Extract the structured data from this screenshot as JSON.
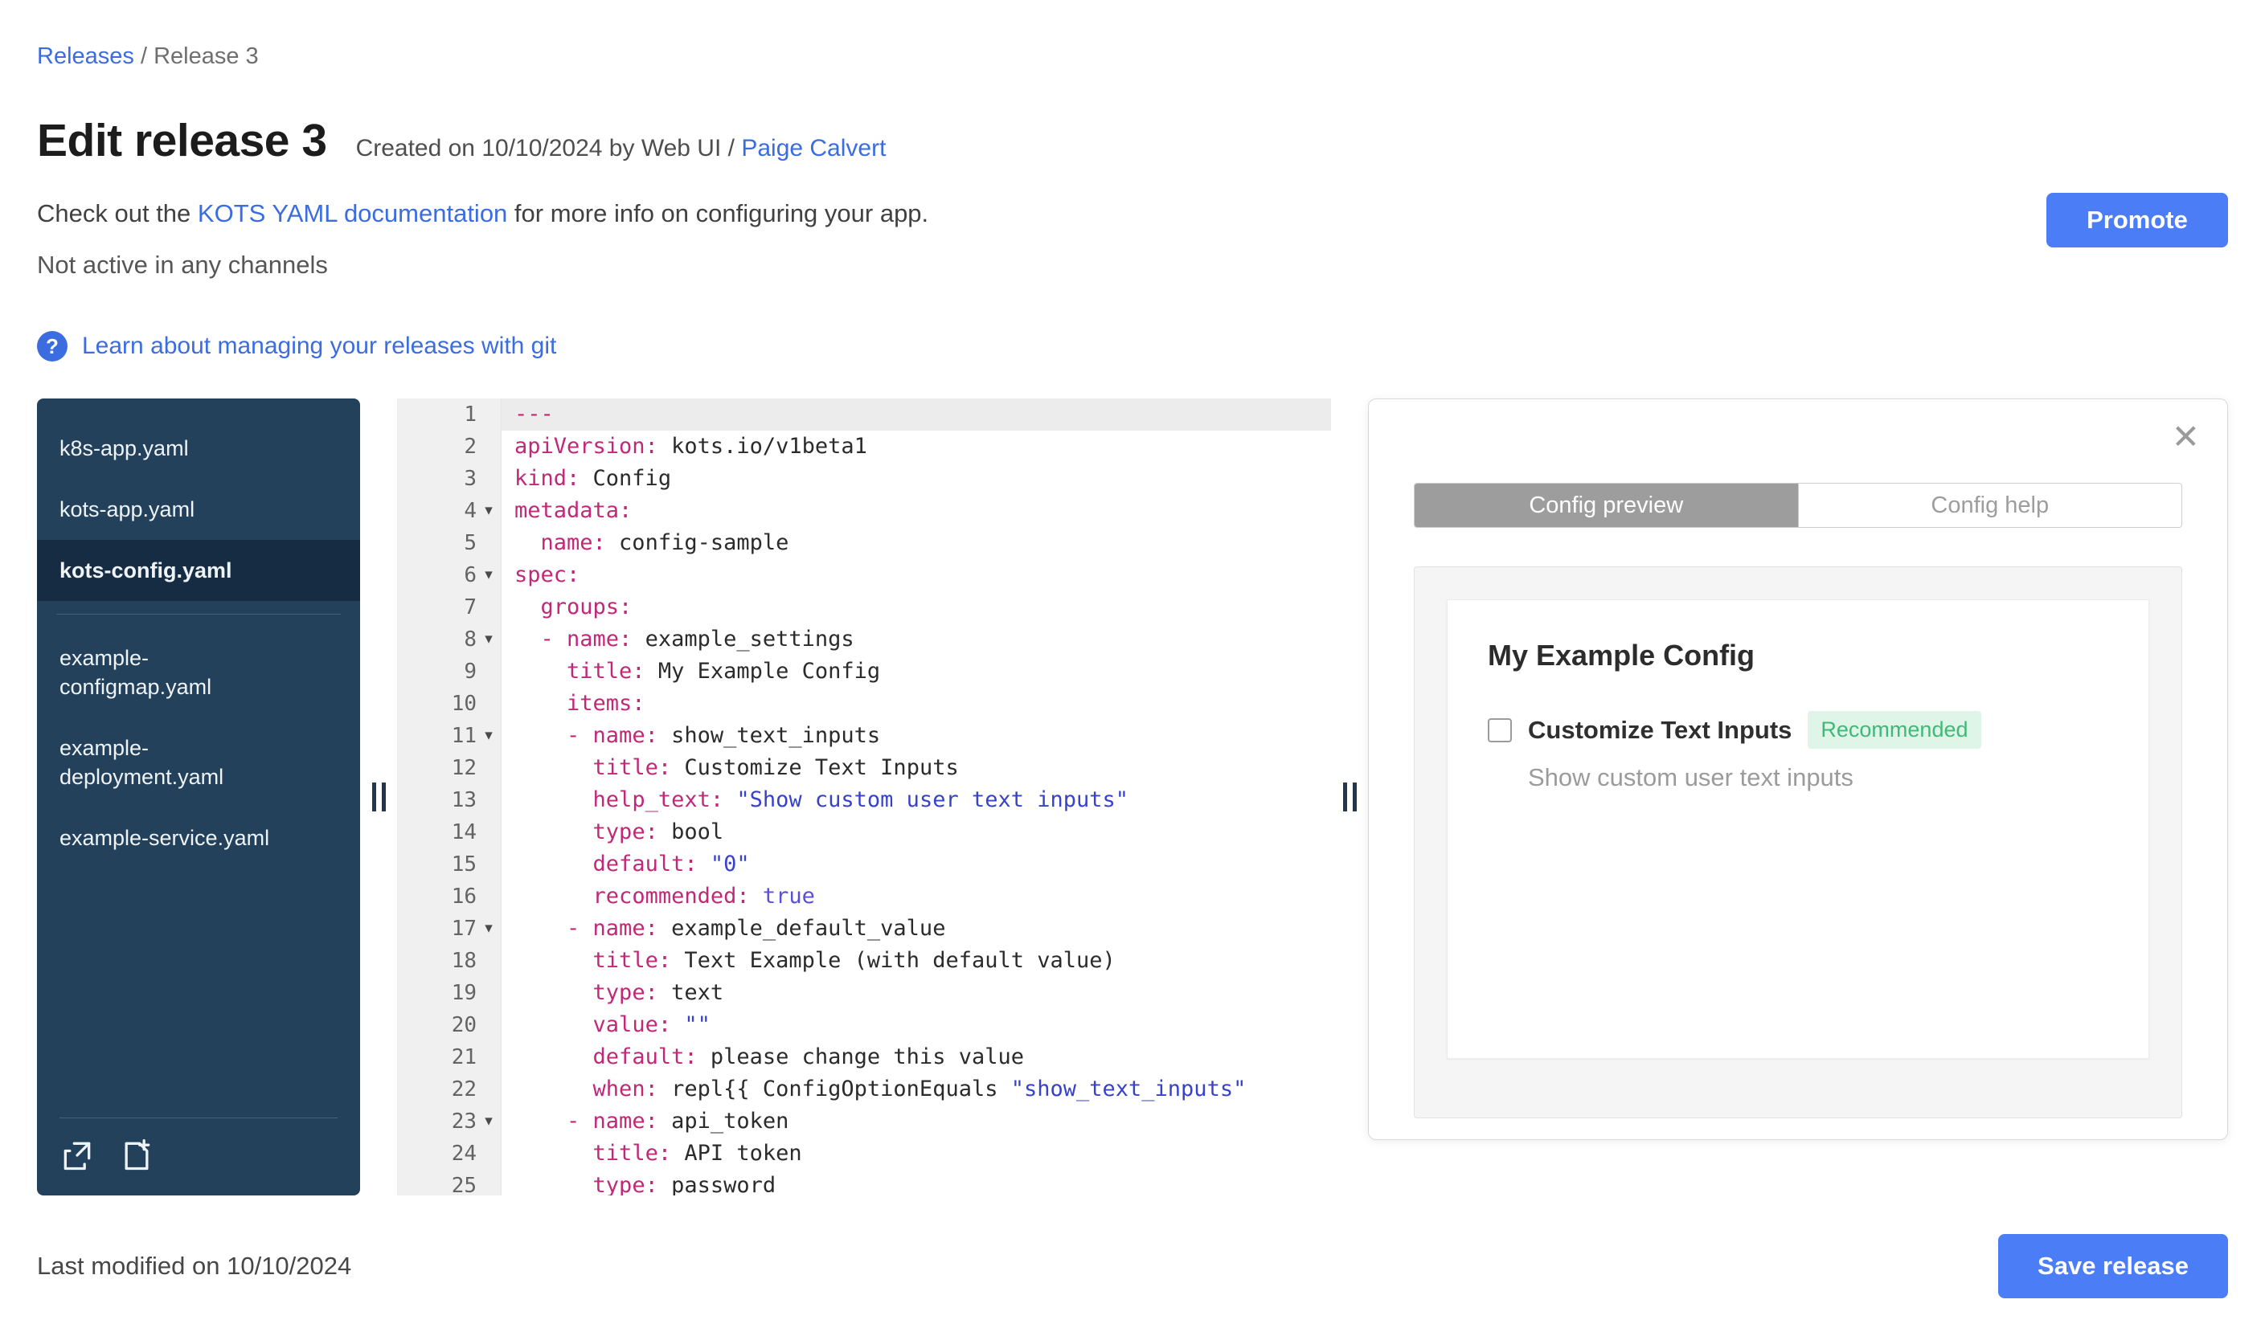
{
  "breadcrumb": {
    "releases": "Releases",
    "separator": "/",
    "current": "Release 3"
  },
  "header": {
    "title": "Edit release 3",
    "created_prefix": "Created on 10/10/2024 by Web UI / ",
    "created_by": "Paige Calvert",
    "docs_prefix": "Check out the ",
    "docs_link": "KOTS YAML documentation",
    "docs_suffix": " for more info on configuring your app.",
    "channel_status": "Not active in any channels",
    "promote_label": "Promote",
    "git_help_link": "Learn about managing your releases with git"
  },
  "icons": {
    "help": "?",
    "close": "✕",
    "fold": "▾"
  },
  "file_tree": {
    "files_top": [
      {
        "label": "k8s-app.yaml",
        "active": false
      },
      {
        "label": "kots-app.yaml",
        "active": false
      },
      {
        "label": "kots-config.yaml",
        "active": true
      }
    ],
    "files_bottom": [
      {
        "label": "example-configmap.yaml",
        "active": false
      },
      {
        "label": "example-deployment.yaml",
        "active": false
      },
      {
        "label": "example-service.yaml",
        "active": false
      }
    ]
  },
  "editor": {
    "lines": [
      {
        "n": 1,
        "fold": false,
        "active": true,
        "seg": [
          {
            "c": "k",
            "t": "---"
          }
        ]
      },
      {
        "n": 2,
        "fold": false,
        "active": false,
        "seg": [
          {
            "c": "k",
            "t": "apiVersion:"
          },
          {
            "c": "v",
            "t": " kots.io/v1beta1"
          }
        ]
      },
      {
        "n": 3,
        "fold": false,
        "active": false,
        "seg": [
          {
            "c": "k",
            "t": "kind:"
          },
          {
            "c": "v",
            "t": " Config"
          }
        ]
      },
      {
        "n": 4,
        "fold": true,
        "active": false,
        "seg": [
          {
            "c": "k",
            "t": "metadata:"
          }
        ]
      },
      {
        "n": 5,
        "fold": false,
        "active": false,
        "seg": [
          {
            "c": "v",
            "t": "  "
          },
          {
            "c": "k",
            "t": "name:"
          },
          {
            "c": "v",
            "t": " config-sample"
          }
        ]
      },
      {
        "n": 6,
        "fold": true,
        "active": false,
        "seg": [
          {
            "c": "k",
            "t": "spec:"
          }
        ]
      },
      {
        "n": 7,
        "fold": false,
        "active": false,
        "seg": [
          {
            "c": "v",
            "t": "  "
          },
          {
            "c": "k",
            "t": "groups:"
          }
        ]
      },
      {
        "n": 8,
        "fold": true,
        "active": false,
        "seg": [
          {
            "c": "v",
            "t": "  "
          },
          {
            "c": "d",
            "t": "- "
          },
          {
            "c": "k",
            "t": "name:"
          },
          {
            "c": "v",
            "t": " example_settings"
          }
        ]
      },
      {
        "n": 9,
        "fold": false,
        "active": false,
        "seg": [
          {
            "c": "v",
            "t": "    "
          },
          {
            "c": "k",
            "t": "title:"
          },
          {
            "c": "v",
            "t": " My Example Config"
          }
        ]
      },
      {
        "n": 10,
        "fold": false,
        "active": false,
        "seg": [
          {
            "c": "v",
            "t": "    "
          },
          {
            "c": "k",
            "t": "items:"
          }
        ]
      },
      {
        "n": 11,
        "fold": true,
        "active": false,
        "seg": [
          {
            "c": "v",
            "t": "    "
          },
          {
            "c": "d",
            "t": "- "
          },
          {
            "c": "k",
            "t": "name:"
          },
          {
            "c": "v",
            "t": " show_text_inputs"
          }
        ]
      },
      {
        "n": 12,
        "fold": false,
        "active": false,
        "seg": [
          {
            "c": "v",
            "t": "      "
          },
          {
            "c": "k",
            "t": "title:"
          },
          {
            "c": "v",
            "t": " Customize Text Inputs"
          }
        ]
      },
      {
        "n": 13,
        "fold": false,
        "active": false,
        "seg": [
          {
            "c": "v",
            "t": "      "
          },
          {
            "c": "k",
            "t": "help_text:"
          },
          {
            "c": "s",
            "t": " \"Show custom user text inputs\""
          }
        ]
      },
      {
        "n": 14,
        "fold": false,
        "active": false,
        "seg": [
          {
            "c": "v",
            "t": "      "
          },
          {
            "c": "k",
            "t": "type:"
          },
          {
            "c": "v",
            "t": " bool"
          }
        ]
      },
      {
        "n": 15,
        "fold": false,
        "active": false,
        "seg": [
          {
            "c": "v",
            "t": "      "
          },
          {
            "c": "k",
            "t": "default:"
          },
          {
            "c": "s",
            "t": " \"0\""
          }
        ]
      },
      {
        "n": 16,
        "fold": false,
        "active": false,
        "seg": [
          {
            "c": "v",
            "t": "      "
          },
          {
            "c": "k",
            "t": "recommended:"
          },
          {
            "c": "b",
            "t": " true"
          }
        ]
      },
      {
        "n": 17,
        "fold": true,
        "active": false,
        "seg": [
          {
            "c": "v",
            "t": "    "
          },
          {
            "c": "d",
            "t": "- "
          },
          {
            "c": "k",
            "t": "name:"
          },
          {
            "c": "v",
            "t": " example_default_value"
          }
        ]
      },
      {
        "n": 18,
        "fold": false,
        "active": false,
        "seg": [
          {
            "c": "v",
            "t": "      "
          },
          {
            "c": "k",
            "t": "title:"
          },
          {
            "c": "v",
            "t": " Text Example (with default value)"
          }
        ]
      },
      {
        "n": 19,
        "fold": false,
        "active": false,
        "seg": [
          {
            "c": "v",
            "t": "      "
          },
          {
            "c": "k",
            "t": "type:"
          },
          {
            "c": "v",
            "t": " text"
          }
        ]
      },
      {
        "n": 20,
        "fold": false,
        "active": false,
        "seg": [
          {
            "c": "v",
            "t": "      "
          },
          {
            "c": "k",
            "t": "value:"
          },
          {
            "c": "s",
            "t": " \"\""
          }
        ]
      },
      {
        "n": 21,
        "fold": false,
        "active": false,
        "seg": [
          {
            "c": "v",
            "t": "      "
          },
          {
            "c": "k",
            "t": "default:"
          },
          {
            "c": "v",
            "t": " please change this value"
          }
        ]
      },
      {
        "n": 22,
        "fold": false,
        "active": false,
        "seg": [
          {
            "c": "v",
            "t": "      "
          },
          {
            "c": "k",
            "t": "when:"
          },
          {
            "c": "v",
            "t": " repl{{ ConfigOptionEquals "
          },
          {
            "c": "s",
            "t": "\"show_text_inputs\""
          }
        ]
      },
      {
        "n": 23,
        "fold": true,
        "active": false,
        "seg": [
          {
            "c": "v",
            "t": "    "
          },
          {
            "c": "d",
            "t": "- "
          },
          {
            "c": "k",
            "t": "name:"
          },
          {
            "c": "v",
            "t": " api_token"
          }
        ]
      },
      {
        "n": 24,
        "fold": false,
        "active": false,
        "seg": [
          {
            "c": "v",
            "t": "      "
          },
          {
            "c": "k",
            "t": "title:"
          },
          {
            "c": "v",
            "t": " API token"
          }
        ]
      },
      {
        "n": 25,
        "fold": false,
        "active": false,
        "seg": [
          {
            "c": "v",
            "t": "      "
          },
          {
            "c": "k",
            "t": "type:"
          },
          {
            "c": "v",
            "t": " password"
          }
        ]
      }
    ]
  },
  "preview": {
    "tabs": [
      {
        "label": "Config preview",
        "active": true
      },
      {
        "label": "Config help",
        "active": false
      }
    ],
    "group_title": "My Example Config",
    "item": {
      "title": "Customize Text Inputs",
      "badge": "Recommended",
      "help_text": "Show custom user text inputs",
      "checked": false
    }
  },
  "footer": {
    "last_modified": "Last modified on 10/10/2024",
    "save_label": "Save release"
  },
  "colors": {
    "accent_button_blue": "#4a7df6",
    "link_blue": "#3b6ce0",
    "sidebar_navy": "#24415c",
    "sidebar_selected": "#152c42",
    "yaml_key_magenta": "#c02879",
    "yaml_string_blue": "#3742cb",
    "badge_green_text": "#41b877",
    "badge_green_bg": "#def5e8",
    "tab_active_gray": "#9d9d9d"
  }
}
